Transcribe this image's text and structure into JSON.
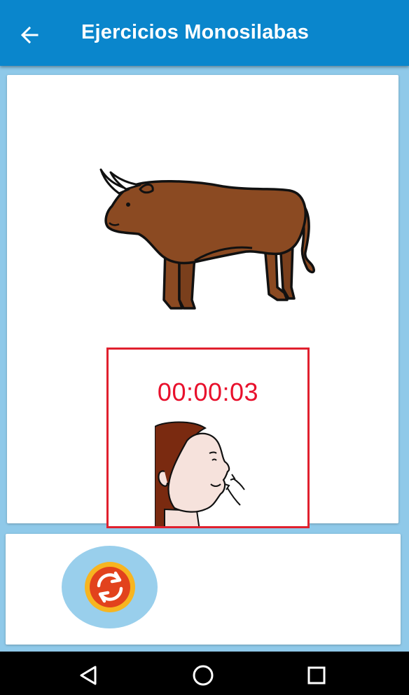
{
  "app_bar": {
    "title": "Ejercicios Monosilabas",
    "back_icon": "arrow-back-icon",
    "color": "#0a86cc"
  },
  "exercise": {
    "picture_icon": "bull-illustration",
    "timer": "00:00:03",
    "timer_color": "#e8102c",
    "pronunciation_icon": "blow-mouth-face-icon",
    "highlight_color": "#e0202e"
  },
  "controls": {
    "refresh_icon": "refresh-icon"
  },
  "system_nav": {
    "back_icon": "nav-back-icon",
    "home_icon": "nav-home-icon",
    "recents_icon": "nav-recents-icon"
  }
}
